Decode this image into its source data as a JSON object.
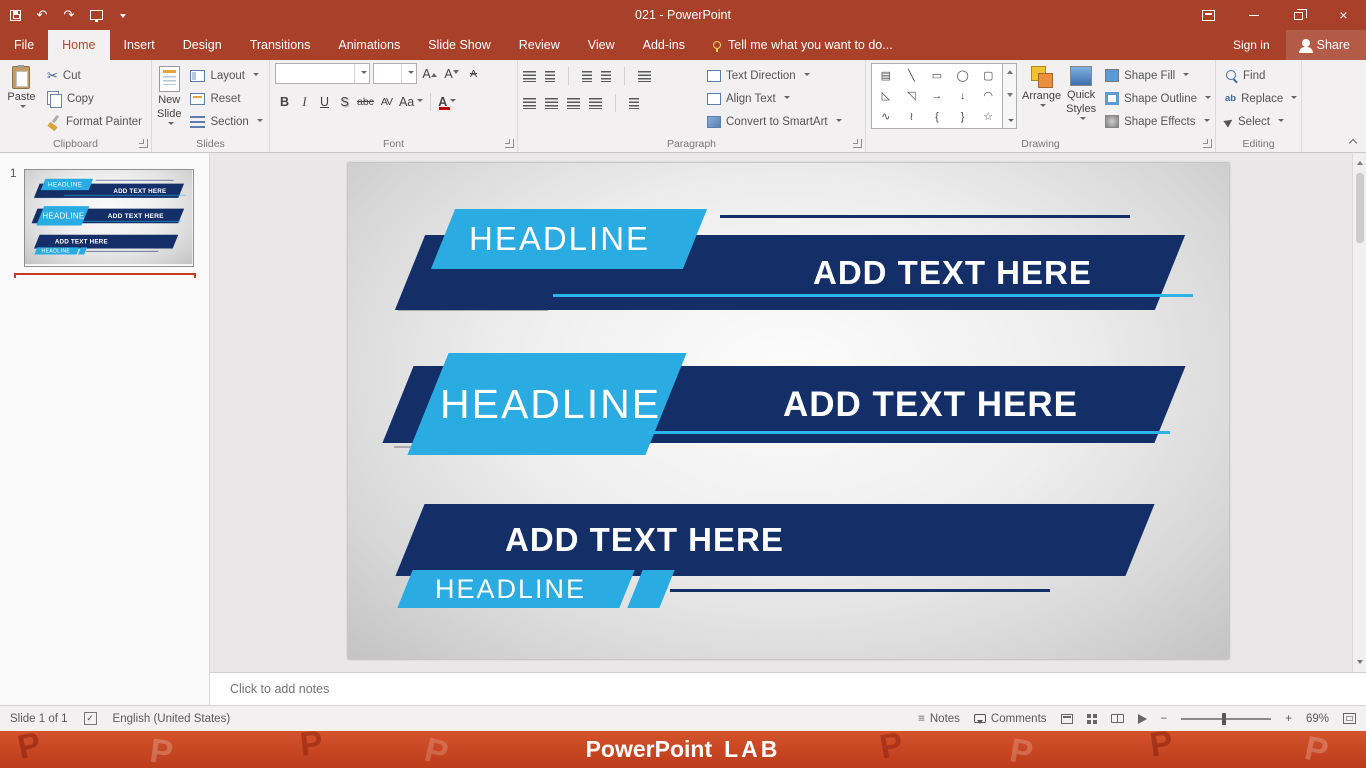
{
  "colors": {
    "titlebar_red": "#a8402a",
    "active_tab_red": "#bf4225",
    "banner_navy": "#142f68",
    "banner_blue": "#2aabe2",
    "footer_red": "#c74522"
  },
  "titlebar": {
    "title": "021 - PowerPoint"
  },
  "icons": {
    "undo": "↶",
    "redo": "↷",
    "cut": "✂",
    "check": "✓",
    "replace_ab": "ab",
    "minus": "−",
    "plus": "+",
    "close": "×",
    "menu_lines": "≡"
  },
  "ribbon": {
    "tabs": [
      "File",
      "Home",
      "Insert",
      "Design",
      "Transitions",
      "Animations",
      "Slide Show",
      "Review",
      "View",
      "Add-ins"
    ],
    "tell_me": "Tell me what you want to do...",
    "sign_in": "Sign in",
    "share": "Share",
    "groups": {
      "clipboard": {
        "label": "Clipboard",
        "paste": "Paste",
        "cut": "Cut",
        "copy": "Copy",
        "format_painter": "Format Painter"
      },
      "slides": {
        "label": "Slides",
        "new_slide": "New Slide",
        "layout": "Layout",
        "reset": "Reset",
        "section": "Section"
      },
      "font": {
        "label": "Font",
        "buttons": [
          "B",
          "I",
          "U",
          "S",
          "abc",
          "AV",
          "Aa",
          "A"
        ],
        "grow": "A",
        "shrink": "A",
        "clear": "A"
      },
      "paragraph": {
        "label": "Paragraph",
        "text_direction": "Text Direction",
        "align_text": "Align Text",
        "convert_smartart": "Convert to SmartArt"
      },
      "drawing": {
        "label": "Drawing",
        "arrange": "Arrange",
        "quick_styles": "Quick Styles",
        "shape_fill": "Shape Fill",
        "shape_outline": "Shape Outline",
        "shape_effects": "Shape Effects",
        "shapes": [
          "▤",
          "╲",
          "▭",
          "◯",
          "▢",
          "◺",
          "◹",
          "→",
          "↓",
          "◠",
          "∿",
          "≀",
          "{",
          "}",
          "☆"
        ]
      },
      "editing": {
        "label": "Editing",
        "find": "Find",
        "replace": "Replace",
        "select": "Select"
      }
    }
  },
  "slide_panel": {
    "slide_number": "1"
  },
  "slide": {
    "banners": {
      "b1": {
        "headline": "HEADLINE",
        "text": "ADD TEXT HERE"
      },
      "b2": {
        "headline": "HEADLINE",
        "text": "ADD TEXT HERE"
      },
      "b3": {
        "headline": "HEADLINE",
        "text": "ADD TEXT HERE"
      }
    }
  },
  "notes": {
    "placeholder": "Click to add notes"
  },
  "status_bar": {
    "slide_indicator": "Slide 1 of 1",
    "language": "English (United States)",
    "notes": "Notes",
    "comments": "Comments",
    "zoom": "69%"
  },
  "footer": {
    "brand_main": "PowerPoint",
    "brand_sub": "LAB",
    "watermark": "P"
  }
}
